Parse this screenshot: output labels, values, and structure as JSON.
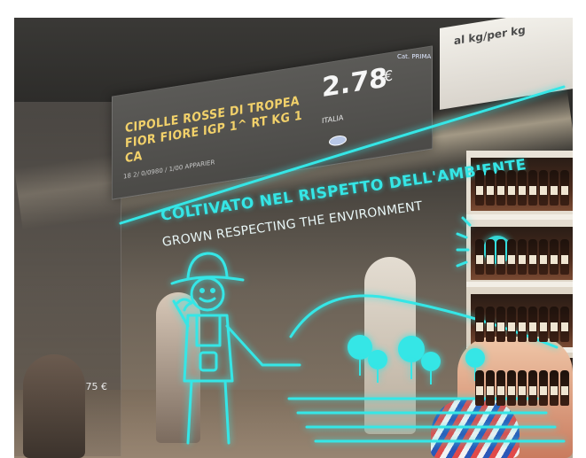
{
  "sign": {
    "product_name": "CIPOLLE ROSSE DI TROPEA FIOR FIORE IGP 1^ RT KG 1 CA",
    "price": "2.78",
    "currency": "€",
    "origin": "ITALIA",
    "code": "18 2/ 0/0980 / 1/00 APPARIER"
  },
  "category_sign": {
    "unit": "al kg/per kg",
    "tag": "Cat. PRIMA"
  },
  "overlay": {
    "headline": "COLTIVATO NEL RISPETTO DELL'AMBIENTE",
    "subhead": "GROWN RESPECTING THE ENVIRONMENT"
  },
  "left_sign": {
    "price": "1.75 €"
  },
  "colors": {
    "overlay_cyan": "#35e6e6",
    "product_yellow": "#f2d16a"
  }
}
